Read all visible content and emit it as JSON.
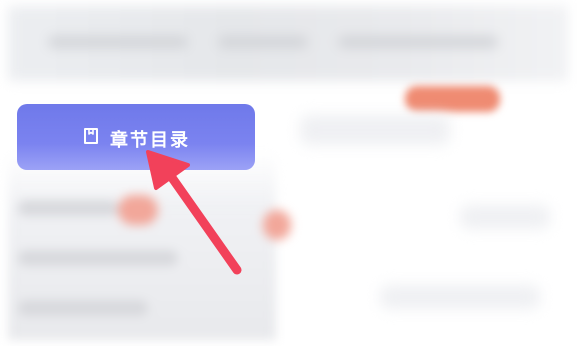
{
  "chapter_button": {
    "label": "章节目录",
    "icon": "bookmark-icon"
  },
  "annotation": {
    "type": "arrow",
    "color": "#f2415a"
  },
  "colors": {
    "button_bg": "#6f79ea",
    "badge": "#ef8b72"
  }
}
